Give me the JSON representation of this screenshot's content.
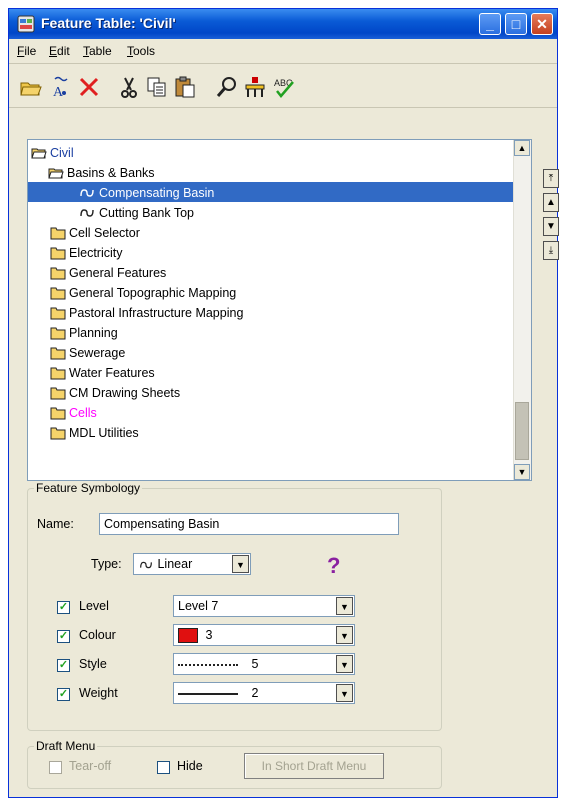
{
  "window": {
    "title": "Feature Table: 'Civil'"
  },
  "menubar": [
    {
      "label": "File",
      "u": "F",
      "rest": "ile"
    },
    {
      "label": "Edit",
      "u": "E",
      "rest": "dit"
    },
    {
      "label": "Table",
      "u": "T",
      "rest": "able"
    },
    {
      "label": "Tools",
      "u": "T",
      "rest": "ools"
    }
  ],
  "toolbar": {
    "icons": [
      "open-folder-icon",
      "rename-icon",
      "delete-icon",
      "cut-icon",
      "copy-icon",
      "paste-icon",
      "find-icon",
      "level-icon",
      "spell-check-icon"
    ]
  },
  "tree": {
    "root": "Civil",
    "items": [
      {
        "label": "Basins & Banks",
        "type": "folder-open"
      },
      {
        "label": "Compensating Basin",
        "type": "linear",
        "selected": true
      },
      {
        "label": "Cutting Bank Top",
        "type": "linear"
      },
      {
        "label": "Cell Selector",
        "type": "folder"
      },
      {
        "label": "Electricity",
        "type": "folder"
      },
      {
        "label": "General Features",
        "type": "folder"
      },
      {
        "label": "General Topographic Mapping",
        "type": "folder"
      },
      {
        "label": "Pastoral Infrastructure Mapping",
        "type": "folder"
      },
      {
        "label": "Planning",
        "type": "folder"
      },
      {
        "label": "Sewerage",
        "type": "folder"
      },
      {
        "label": "Water Features",
        "type": "folder"
      },
      {
        "label": "CM Drawing Sheets",
        "type": "folder"
      },
      {
        "label": "Cells",
        "type": "folder",
        "color": "#ff00ff"
      },
      {
        "label": "MDL Utilities",
        "type": "folder"
      }
    ]
  },
  "symbology": {
    "legend": "Feature Symbology",
    "name_label": "Name:",
    "name_value": "Compensating Basin",
    "type_label": "Type:",
    "type_value": "Linear",
    "help": "?",
    "level_label": "Level",
    "level_value": "Level 7",
    "colour_label": "Colour",
    "colour_value": "3",
    "colour_swatch": "#e01010",
    "style_label": "Style",
    "style_value": "5",
    "weight_label": "Weight",
    "weight_value": "2"
  },
  "draft": {
    "legend": "Draft Menu",
    "tearoff": "Tear-off",
    "hide": "Hide",
    "button": "In Short Draft Menu"
  },
  "colors": {
    "title_blue": "#0a5bd6",
    "selection": "#316ac5",
    "folder": "#f5d36a",
    "check": "#21a121"
  }
}
